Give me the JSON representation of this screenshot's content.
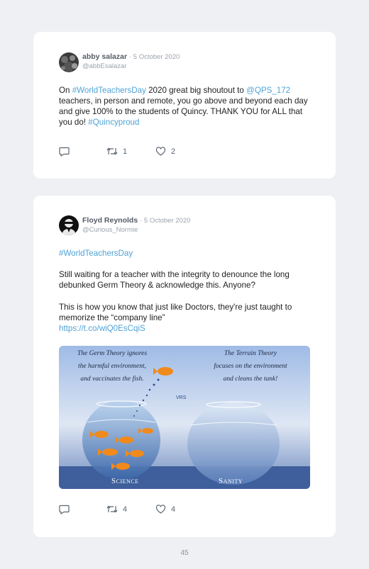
{
  "tweets": [
    {
      "name": "abby salazar",
      "date": "· 5 October 2020",
      "handle": "@abbEsalazar",
      "text_parts": [
        {
          "t": "On ",
          "link": false
        },
        {
          "t": "#WorldTeachersDay",
          "link": true
        },
        {
          "t": " 2020 great big shoutout to ",
          "link": false
        },
        {
          "t": "@QPS_172",
          "link": true
        },
        {
          "t": " teachers, in person and remote, you go above and beyond each day and give 100% to the students of Quincy. THANK YOU for ALL that you do! ",
          "link": false
        },
        {
          "t": "#Quincyproud",
          "link": true
        }
      ],
      "retweets": "1",
      "likes": "2"
    },
    {
      "name": "Floyd Reynolds",
      "date": "· 5 October 2020",
      "handle": "@Curious_Normie",
      "hashtag": "#WorldTeachersDay",
      "para1": "Still waiting for a teacher with the integrity to denounce the long debunked Germ Theory & acknowledge this. Anyone?",
      "para2": "This is how you know that just like Doctors, they're just taught to memorize the “company line”",
      "url": "https://t.co/wiQ0EsCqiS",
      "image": {
        "left_caption": [
          "The Germ Theory ignores",
          "the harmful environment,",
          "and vaccinates the fish."
        ],
        "right_caption": [
          "The Terrain Theory",
          "focuses on the environment",
          "and cleans the tank!"
        ],
        "vrs": "VRS",
        "left_label": "Science",
        "right_label": "Sanity"
      },
      "retweets": "4",
      "likes": "4"
    }
  ],
  "page_number": "45",
  "colors": {
    "link": "#4fa3d6",
    "background": "#eef0f3",
    "card": "#ffffff"
  }
}
